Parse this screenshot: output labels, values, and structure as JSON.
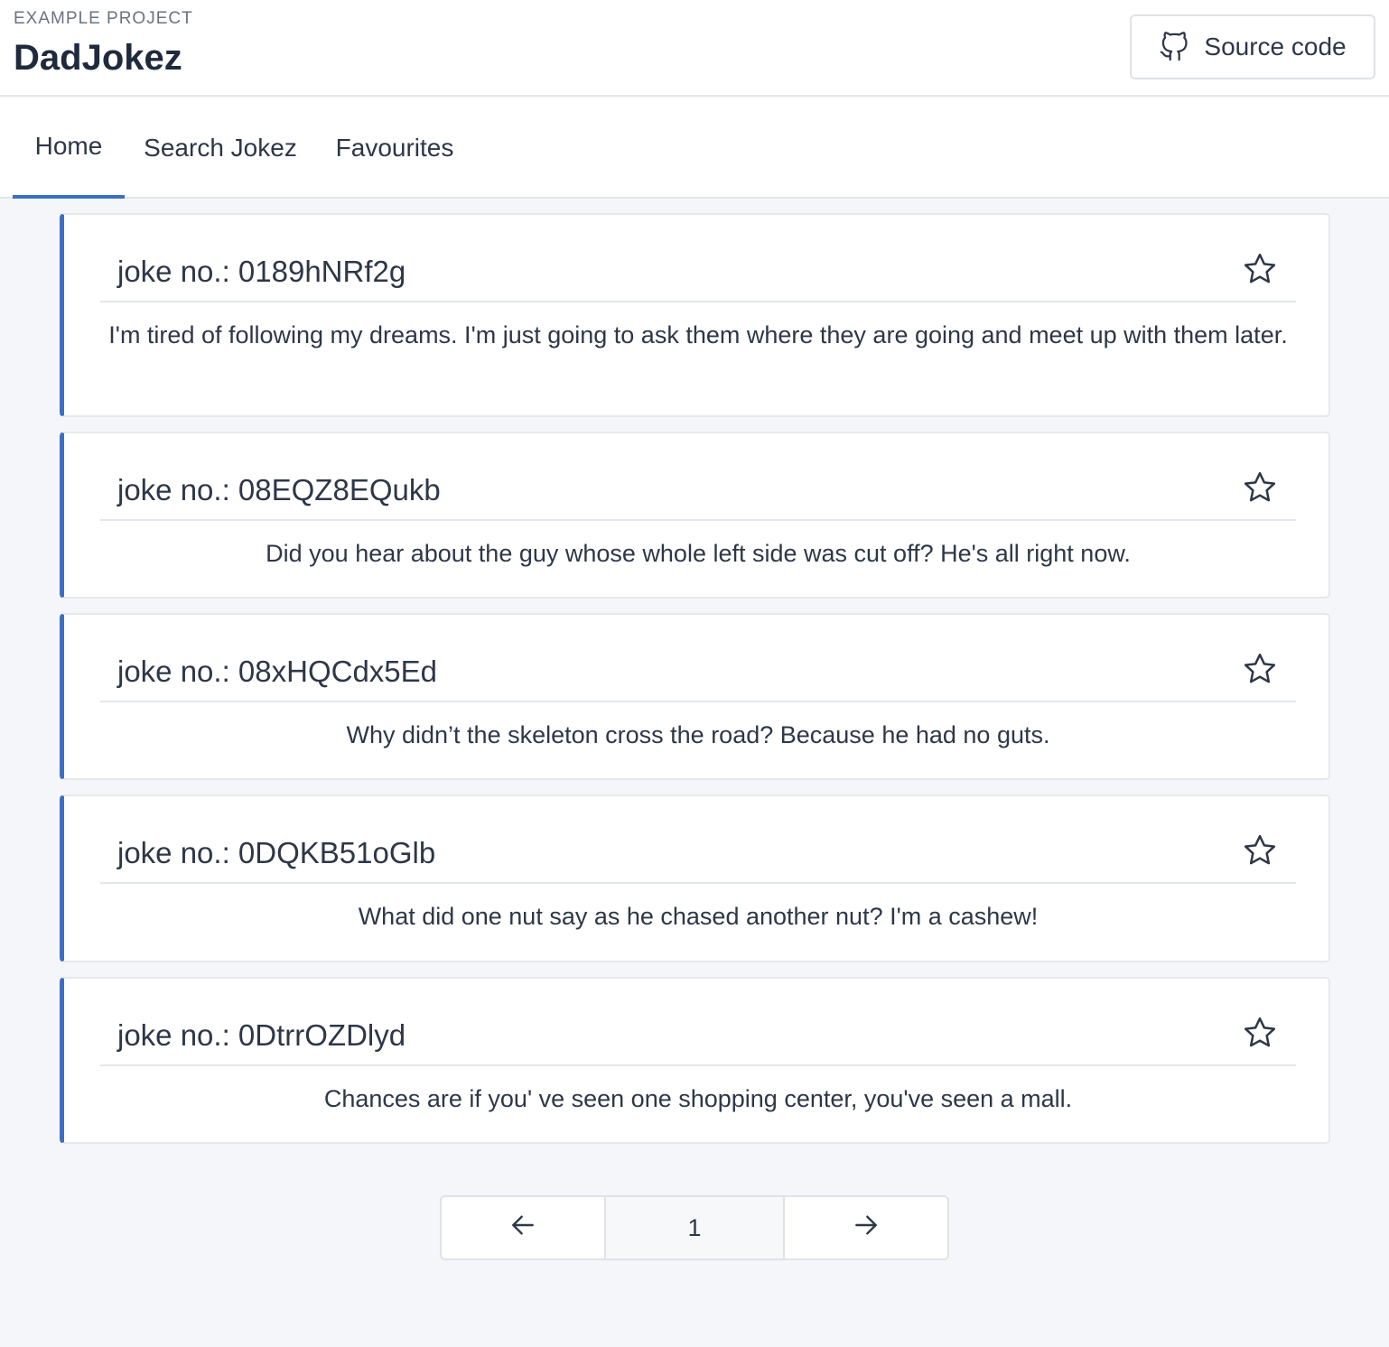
{
  "header": {
    "eyebrow": "EXAMPLE PROJECT",
    "title": "DadJokez",
    "source_button": {
      "label": "Source code",
      "icon": "github-icon"
    }
  },
  "nav": {
    "tabs": [
      {
        "label": "Home",
        "active": true
      },
      {
        "label": "Search Jokez",
        "active": false
      },
      {
        "label": "Favourites",
        "active": false
      }
    ]
  },
  "jokes": [
    {
      "title": "joke no.: 0189hNRf2g",
      "text": "I'm tired of following my dreams. I'm just going to ask them where they are going and meet up with them later.",
      "favorite_icon": "star-outline-icon"
    },
    {
      "title": "joke no.: 08EQZ8EQukb",
      "text": "Did you hear about the guy whose whole left side was cut off? He's all right now.",
      "favorite_icon": "star-outline-icon"
    },
    {
      "title": "joke no.: 08xHQCdx5Ed",
      "text": "Why didn’t the skeleton cross the road? Because he had no guts.",
      "favorite_icon": "star-outline-icon"
    },
    {
      "title": "joke no.: 0DQKB51oGlb",
      "text": "What did one nut say as he chased another nut? I'm a cashew!",
      "favorite_icon": "star-outline-icon"
    },
    {
      "title": "joke no.: 0DtrrOZDlyd",
      "text": "Chances are if you' ve seen one shopping center, you've seen a mall.",
      "favorite_icon": "star-outline-icon"
    }
  ],
  "pagination": {
    "prev_icon": "arrow-left-icon",
    "current_page": "1",
    "next_icon": "arrow-right-icon"
  },
  "colors": {
    "accent": "#3a6fc4",
    "background": "#f5f6f9",
    "text": "#2d3748"
  }
}
